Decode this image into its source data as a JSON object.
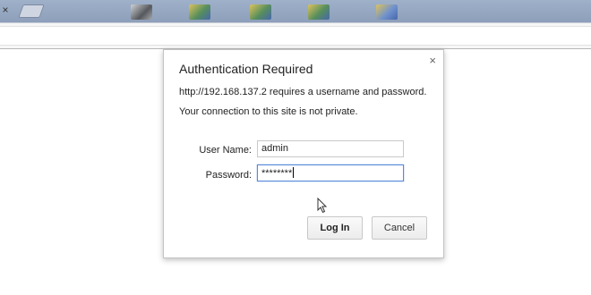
{
  "browser": {
    "tab_close": "×",
    "tab_icons": [
      "tab-favicon-1",
      "tab-favicon-2",
      "tab-favicon-3",
      "tab-favicon-4",
      "tab-favicon-5"
    ]
  },
  "dialog": {
    "title": "Authentication Required",
    "message_line1": "http://192.168.137.2 requires a username and password.",
    "message_line2": "Your connection to this site is not private.",
    "close_glyph": "×",
    "username_label": "User Name:",
    "username_value": "admin",
    "password_label": "Password:",
    "password_value": "********",
    "login_label": "Log In",
    "cancel_label": "Cancel"
  },
  "colors": {
    "tabstrip": "#9fb0c9",
    "focus_border": "#5a8ad8"
  }
}
